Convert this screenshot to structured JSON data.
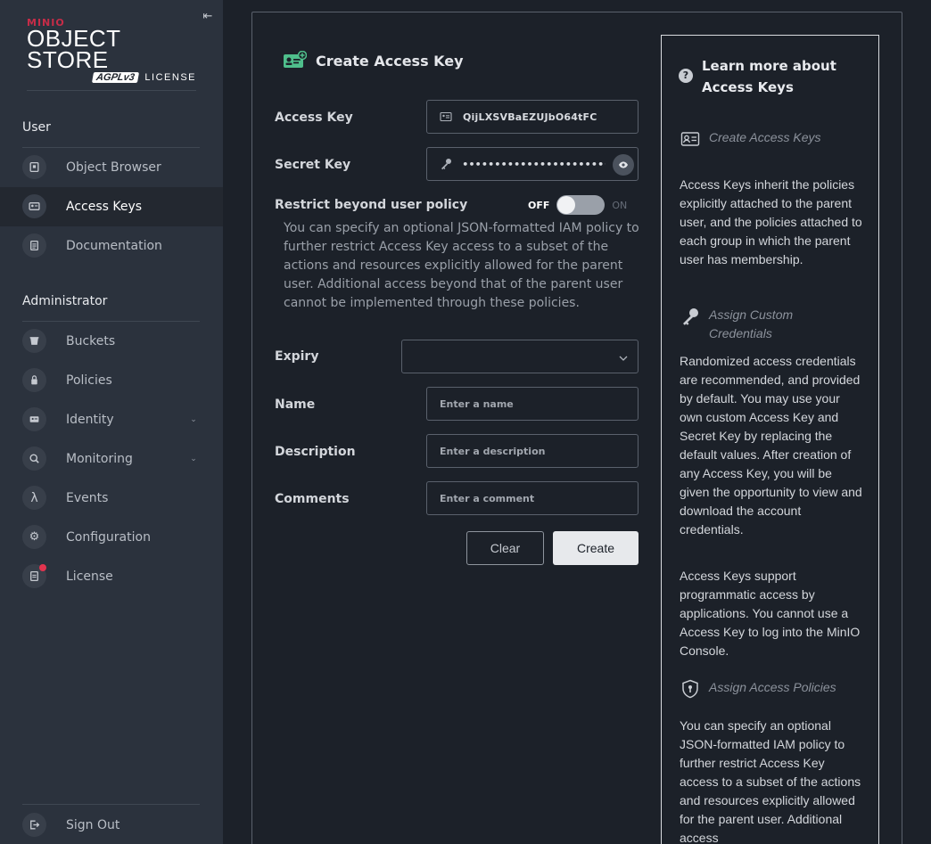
{
  "sidebar": {
    "logo": {
      "brand": "MINIO",
      "product": "OBJECT STORE",
      "license_badge": "AGPLv3",
      "license_word": "LICENSE"
    },
    "collapse_icon": "collapse-left-icon",
    "user_section": "User",
    "user_items": [
      {
        "label": "Object Browser",
        "icon": "bucket-browse-icon"
      },
      {
        "label": "Access Keys",
        "icon": "id-card-icon",
        "active": true
      },
      {
        "label": "Documentation",
        "icon": "doc-icon"
      }
    ],
    "admin_section": "Administrator",
    "admin_items": [
      {
        "label": "Buckets",
        "icon": "bucket-icon"
      },
      {
        "label": "Policies",
        "icon": "lock-icon"
      },
      {
        "label": "Identity",
        "icon": "identity-icon",
        "expandable": true
      },
      {
        "label": "Monitoring",
        "icon": "monitoring-icon",
        "expandable": true
      },
      {
        "label": "Events",
        "icon": "lambda-icon"
      },
      {
        "label": "Configuration",
        "icon": "gear-icon"
      },
      {
        "label": "License",
        "icon": "license-icon",
        "badge": true
      }
    ],
    "signout": "Sign Out"
  },
  "form": {
    "title": "Create Access Key",
    "access_key_label": "Access Key",
    "access_key_value": "QijLXSVBaEZUJbO64tFC",
    "secret_key_label": "Secret Key",
    "secret_key_value": "••••••••••••••••••••••••••••••••••••••••",
    "restrict_label": "Restrict beyond user policy",
    "toggle_off": "OFF",
    "toggle_on": "ON",
    "toggle_state": "off",
    "restrict_help": "You can specify an optional JSON-formatted IAM policy to further restrict Access Key access to a subset of the actions and resources explicitly allowed for the parent user. Additional access beyond that of the parent user cannot be implemented through these policies.",
    "expiry_label": "Expiry",
    "expiry_value": "",
    "name_label": "Name",
    "name_placeholder": "Enter a name",
    "description_label": "Description",
    "description_placeholder": "Enter a description",
    "comments_label": "Comments",
    "comments_placeholder": "Enter a comment",
    "clear_button": "Clear",
    "create_button": "Create"
  },
  "help": {
    "title": "Learn more about Access Keys",
    "sections": [
      {
        "heading": "Create Access Keys",
        "icon": "id-card-icon",
        "paragraphs": [
          "Access Keys inherit the policies explicitly attached to the parent user, and the policies attached to each group in which the parent user has membership."
        ]
      },
      {
        "heading": "Assign Custom Credentials",
        "icon": "key-icon",
        "paragraphs": [
          "Randomized access credentials are recommended, and provided by default. You may use your own custom Access Key and Secret Key by replacing the default values. After creation of any Access Key, you will be given the opportunity to view and download the account credentials.",
          "Access Keys support programmatic access by applications. You cannot use a Access Key to log into the MinIO Console."
        ]
      },
      {
        "heading": "Assign Access Policies",
        "icon": "shield-icon",
        "paragraphs": [
          "You can specify an optional JSON-formatted IAM policy to further restrict Access Key access to a subset of the actions and resources explicitly allowed for the parent user. Additional access"
        ]
      }
    ]
  }
}
